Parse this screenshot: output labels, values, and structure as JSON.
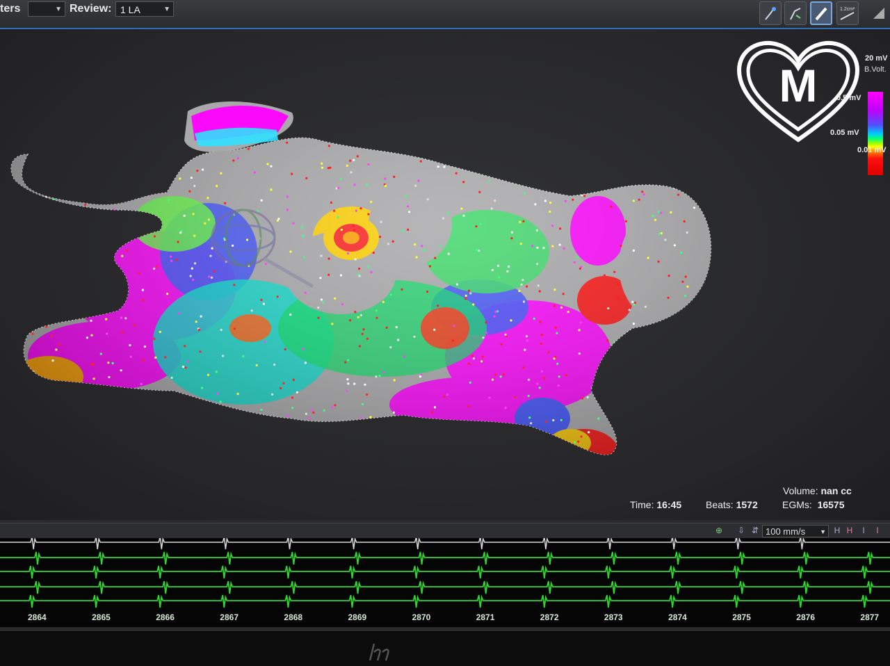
{
  "toolbar": {
    "left_label_partial": "ters",
    "review_label": "Review:",
    "review_value": "1 LA",
    "tools": [
      "catheter-icon",
      "point-collect-icon",
      "pencil-icon",
      "area-measure-icon"
    ],
    "area_tool_text": "1.2cm²"
  },
  "logo": {
    "letter": "M",
    "shape": "heart-icon"
  },
  "legend": {
    "title": "B.Volt.",
    "max": "20 mV",
    "mid": "0.5 mV",
    "low": "0.05 mV",
    "min": "0.01 mV"
  },
  "stats": {
    "volume_label": "Volume:",
    "volume_value": "nan cc",
    "time_label": "Time:",
    "time_value": "16:45",
    "beats_label": "Beats:",
    "beats_value": "1572",
    "egms_label": "EGMs:",
    "egms_value": "16575"
  },
  "egm": {
    "speed": "100 mm/s",
    "beat_numbers": [
      "2864",
      "2865",
      "2866",
      "2867",
      "2868",
      "2869",
      "2870",
      "2871",
      "2872",
      "2873",
      "2874",
      "2875",
      "2876",
      "2877"
    ],
    "trace_count": 5,
    "colors": {
      "ecg": "#d8d8d8",
      "egm": "#2dd82d"
    }
  },
  "colors": {
    "accent": "#2f6fb8",
    "map_high": "#ff00ff",
    "map_low": "#ff1010",
    "map_scar": "#a9a9a9"
  }
}
